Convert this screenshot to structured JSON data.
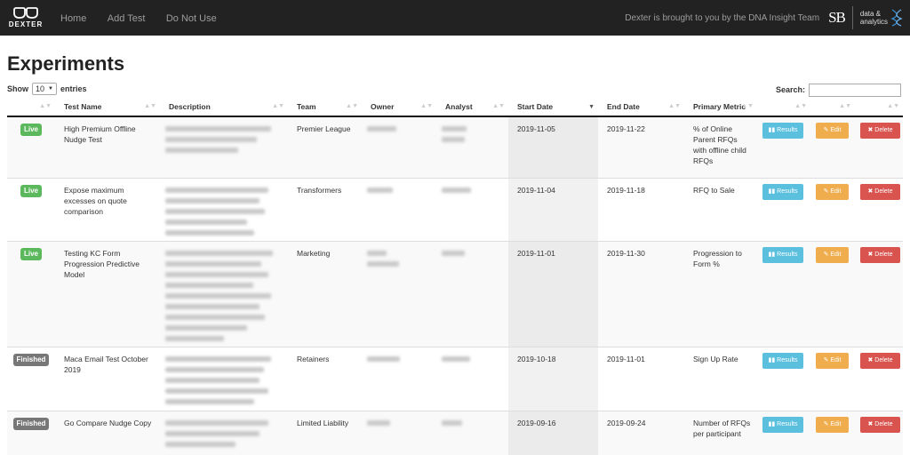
{
  "nav": {
    "brand": "DEXTER",
    "links": [
      "Home",
      "Add Test",
      "Do Not Use"
    ],
    "tagline": "Dexter is brought to you by the DNA Insight Team",
    "sb_logo": "SB",
    "da_line1": "data &",
    "da_line2": "analytics"
  },
  "page": {
    "title": "Experiments",
    "show_label": "Show",
    "entries_value": "10",
    "entries_label": "entries",
    "search_label": "Search:"
  },
  "table": {
    "headers": [
      "",
      "Test Name",
      "Description",
      "Team",
      "Owner",
      "Analyst",
      "Start Date",
      "End Date",
      "Primary Metric",
      "",
      "",
      ""
    ],
    "buttons": {
      "results": "Results",
      "edit": "Edit",
      "delete": "Delete"
    },
    "rows": [
      {
        "status": "Live",
        "name": "High Premium Offline Nudge Test",
        "team": "Premier League",
        "start": "2019-11-05",
        "end": "2019-11-22",
        "metric": "% of Online Parent RFQs with offline child RFQs"
      },
      {
        "status": "Live",
        "name": "Expose maximum excesses on quote comparison",
        "team": "Transformers",
        "start": "2019-11-04",
        "end": "2019-11-18",
        "metric": "RFQ to Sale"
      },
      {
        "status": "Live",
        "name": "Testing KC Form Progression Predictive Model",
        "team": "Marketing",
        "start": "2019-11-01",
        "end": "2019-11-30",
        "metric": "Progression to Form %"
      },
      {
        "status": "Finished",
        "name": "Maca Email Test October 2019",
        "team": "Retainers",
        "start": "2019-10-18",
        "end": "2019-11-01",
        "metric": "Sign Up Rate"
      },
      {
        "status": "Finished",
        "name": "Go Compare Nudge Copy",
        "team": "Limited Liability",
        "start": "2019-09-16",
        "end": "2019-09-24",
        "metric": "Number of RFQs per participant"
      }
    ]
  },
  "colors": {
    "live": "#5cb85c",
    "finished": "#777777",
    "results": "#5bc0de",
    "edit": "#f0ad4e",
    "delete": "#d9534f",
    "navbar": "#222222"
  }
}
